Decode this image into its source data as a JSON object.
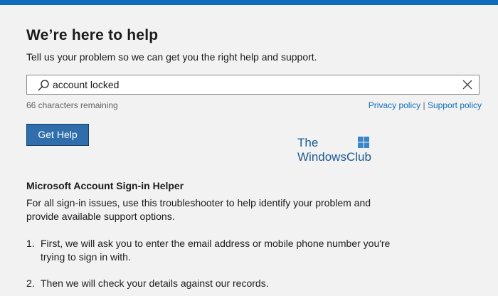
{
  "header": {
    "title": "We’re here to help",
    "subtitle": "Tell us your problem so we can get you the right help and support."
  },
  "search": {
    "value": "account locked",
    "chars_remaining": "66 characters remaining"
  },
  "links": {
    "privacy": "Privacy policy",
    "separator": "|",
    "support": "Support policy"
  },
  "button": {
    "label": "Get Help"
  },
  "watermark": {
    "line1": "The",
    "line2": "WindowsClub"
  },
  "helper": {
    "title": "Microsoft Account Sign-in Helper",
    "description": "For all sign-in issues, use this troubleshooter to help identify your problem and provide available support options.",
    "steps": [
      {
        "num": "1.",
        "text": "First, we will ask you to enter the email address or mobile phone number you're trying to sign in with."
      },
      {
        "num": "2.",
        "text": "Then we will check your details against our records."
      }
    ]
  },
  "colors": {
    "accent": "#0f6cbd",
    "button_bg": "#2f6eab",
    "background": "#f2f2f2"
  }
}
